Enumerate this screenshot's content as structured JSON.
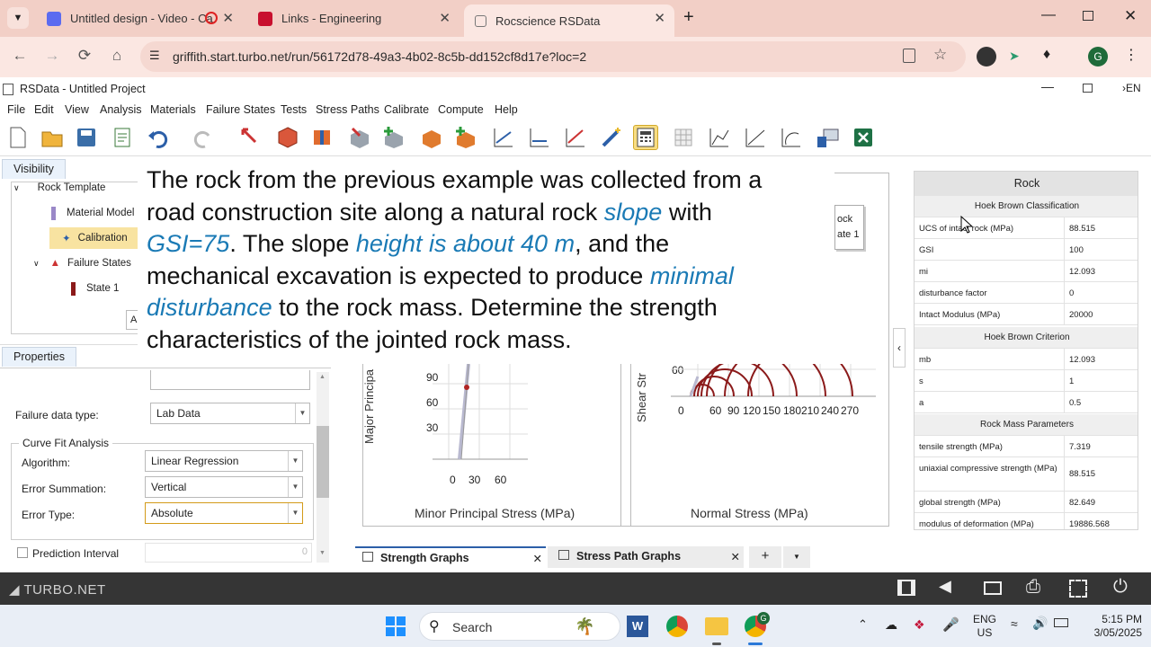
{
  "browser": {
    "tabs": [
      {
        "title": "Untitled design - Video - Ca"
      },
      {
        "title": "Links - Engineering"
      },
      {
        "title": "Rocscience RSData"
      }
    ],
    "url": "griffith.start.turbo.net/run/56172d78-49a3-4b02-8c5b-dd152cf8d17e?loc=2",
    "profile_initial": "G"
  },
  "app": {
    "title": "RSData - Untitled Project",
    "lang": "EN",
    "menus": [
      "File",
      "Edit",
      "View",
      "Analysis",
      "Materials",
      "Failure States",
      "Tests",
      "Stress Paths",
      "Calibrate",
      "Compute",
      "Help"
    ]
  },
  "visibility": {
    "tab": "Visibility",
    "items": [
      "Rock Template",
      "Material Model",
      "Calibration",
      "Failure States",
      "State 1"
    ]
  },
  "properties": {
    "tab": "Properties",
    "failure_data_type_label": "Failure data type:",
    "failure_data_type_value": "Lab Data",
    "curve_fit_group": "Curve Fit Analysis",
    "algorithm_label": "Algorithm:",
    "algorithm_value": "Linear Regression",
    "error_summation_label": "Error Summation:",
    "error_summation_value": "Vertical",
    "error_type_label": "Error Type:",
    "error_type_value": "Absolute",
    "prediction_interval_label": "Prediction Interval",
    "prediction_interval_value": "0"
  },
  "graphs": {
    "legend_partial": [
      "ock",
      "ate 1"
    ],
    "left": {
      "xlabel": "Minor Principal Stress (MPa)",
      "ylabel": "Major Principa",
      "yticks": [
        "90",
        "60",
        "30"
      ],
      "xticks": [
        "0",
        "30",
        "60"
      ]
    },
    "right": {
      "xlabel": "Normal Stress (MPa)",
      "ylabel": "Shear Str",
      "yticks": [
        "60"
      ],
      "xticks": [
        "0",
        "60",
        "90",
        "120",
        "150",
        "180",
        "210",
        "240",
        "270"
      ]
    },
    "bottom_tabs": [
      "Strength Graphs",
      "Stress Path Graphs"
    ]
  },
  "caption": {
    "l1": "The rock from the previous example was collected from a",
    "l2a": "road construction site along a natural rock ",
    "l2b": "slope",
    "l2c": " with",
    "l3a": "GSI=75",
    "l3b": ". The slope ",
    "l3c": "height is about 40 m",
    "l3d": ", and the",
    "l4a": "mechanical excavation is expected to produce ",
    "l4b": "minimal",
    "l5a": "disturbance",
    "l5b": " to the rock mass. Determine the strength",
    "l6": "characteristics of the jointed rock mass."
  },
  "rock_table": {
    "header": "Rock",
    "sections": [
      {
        "title": "Hoek Brown Classification",
        "rows": [
          {
            "k": "UCS of intact rock (MPa)",
            "v": "88.515"
          },
          {
            "k": "GSI",
            "v": "100"
          },
          {
            "k": "mi",
            "v": "12.093"
          },
          {
            "k": "disturbance factor",
            "v": "0"
          },
          {
            "k": "Intact Modulus (MPa)",
            "v": "20000"
          }
        ]
      },
      {
        "title": "Hoek Brown Criterion",
        "rows": [
          {
            "k": "mb",
            "v": "12.093"
          },
          {
            "k": "s",
            "v": "1"
          },
          {
            "k": "a",
            "v": "0.5"
          }
        ]
      },
      {
        "title": "Rock Mass Parameters",
        "rows": [
          {
            "k": "tensile strength (MPa)",
            "v": "7.319"
          },
          {
            "k": "uniaxial compressive strength (MPa)",
            "v": "88.515"
          },
          {
            "k": "global strength (MPa)",
            "v": "82.649"
          },
          {
            "k": "modulus of deformation (MPa)",
            "v": "19886.568"
          }
        ]
      }
    ]
  },
  "turbo": {
    "brand": "TURBO.NET"
  },
  "taskbar": {
    "search": "Search",
    "lang1": "ENG",
    "lang2": "US",
    "time": "5:15 PM",
    "date": "3/05/2025",
    "chrome_badge": "G"
  }
}
